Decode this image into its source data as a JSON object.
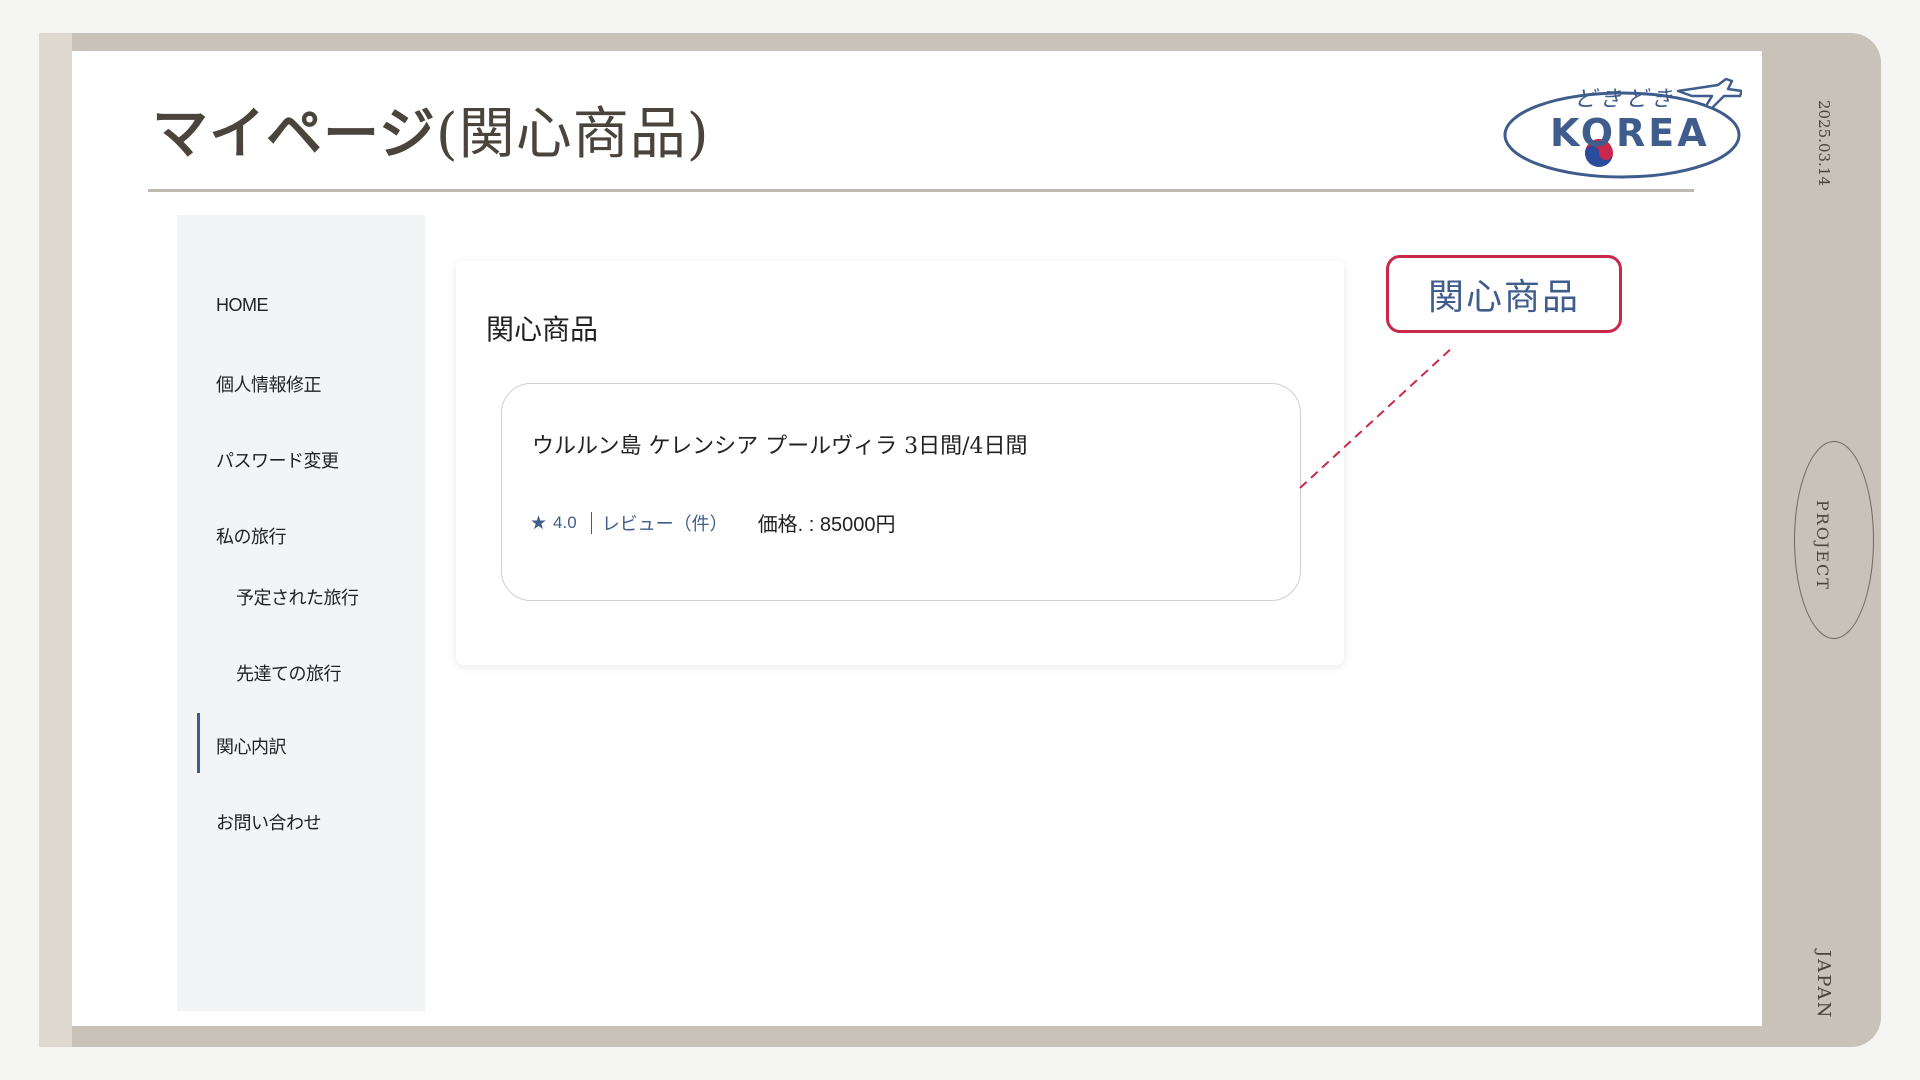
{
  "page": {
    "title_bold": "マイページ",
    "title_paren": "(関心商品)",
    "date": "2025.03.14",
    "project": "PROJECT",
    "country": "JAPAN"
  },
  "logo": {
    "hiragana": "どきどき",
    "text": "KOREA"
  },
  "sidebar": {
    "items": [
      {
        "label": "HOME"
      },
      {
        "label": "個人情報修正"
      },
      {
        "label": "パスワード変更"
      },
      {
        "label": "私の旅行"
      },
      {
        "label": "予定された旅行"
      },
      {
        "label": "先達ての旅行"
      },
      {
        "label": "関心内訳"
      },
      {
        "label": "お問い合わせ"
      }
    ],
    "active_item": "関心内訳"
  },
  "main": {
    "heading": "関心商品",
    "products": [
      {
        "title": "ウルルン島 ケレンシア プールヴィラ 3日間/4日間",
        "rating": "4.0",
        "review_label": "レビュー（件）",
        "price_label": "価格. : 85000円"
      }
    ]
  },
  "annotation": {
    "label": "関心商品",
    "border_color": "#c8284a"
  },
  "colors": {
    "accent": "#3f5d8c",
    "frame": "#c8c2b8",
    "title": "#4a443c"
  }
}
